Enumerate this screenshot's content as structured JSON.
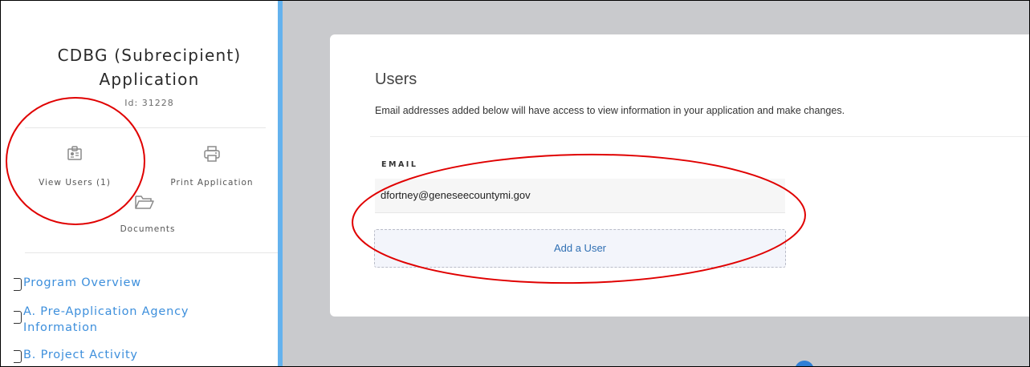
{
  "app": {
    "title": "CDBG (Subrecipient) Application",
    "id_label": "Id: 31228"
  },
  "actions": {
    "view_users": "View Users (1)",
    "print_application": "Print Application",
    "documents": "Documents"
  },
  "nav": {
    "items": [
      {
        "label": "Program Overview"
      },
      {
        "label": "A. Pre-Application Agency Information"
      },
      {
        "label": "B. Project Activity"
      }
    ]
  },
  "users_panel": {
    "title": "Users",
    "description": "Email addresses added below will have access to view information in your application and make changes.",
    "column_header": "EMAIL",
    "emails": [
      "dfortney@geneseecountymi.gov"
    ],
    "add_button": "Add a User"
  },
  "colors": {
    "accent_blue": "#3d8fdc",
    "sidebar_bar": "#64b2ee",
    "annotation_red": "#e00000",
    "main_bg": "#c9cacd"
  },
  "icons": [
    "badge-icon",
    "printer-icon",
    "folder-icon"
  ]
}
